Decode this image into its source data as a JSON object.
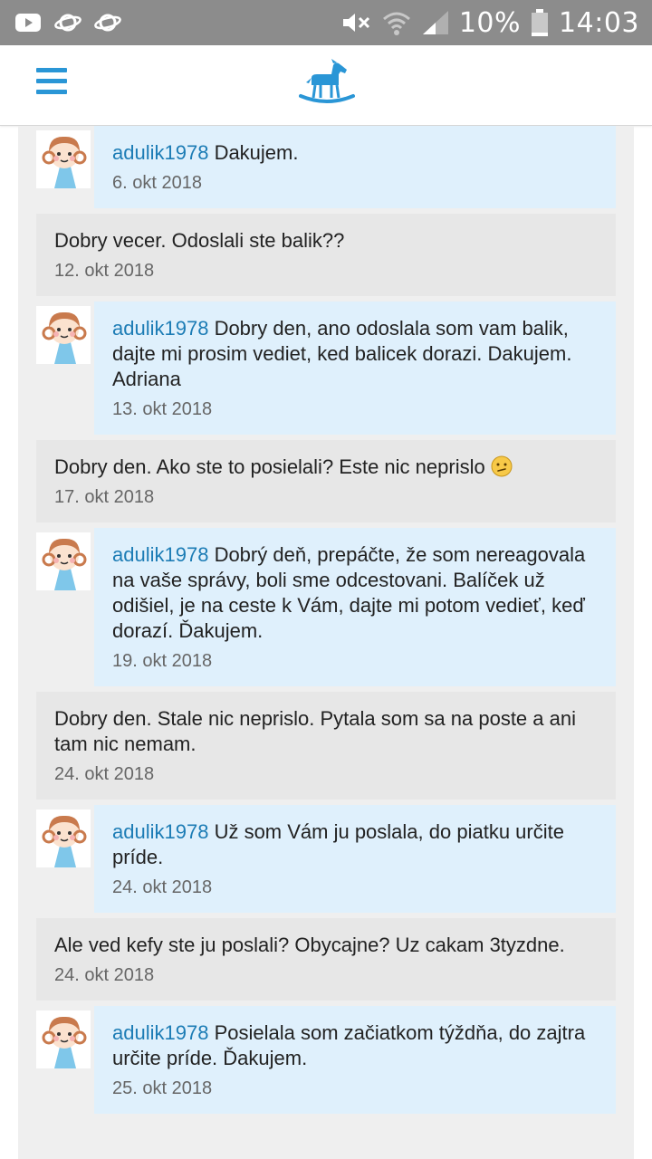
{
  "statusbar": {
    "battery": "10%",
    "time": "14:03"
  },
  "thread": {
    "messages": [
      {
        "type": "outgoing",
        "user": "adulik1978",
        "text": "Dakujem.",
        "date": "6. okt 2018"
      },
      {
        "type": "incoming",
        "text": "Dobry vecer. Odoslali ste balik??",
        "date": "12. okt 2018"
      },
      {
        "type": "outgoing",
        "user": "adulik1978",
        "text": "Dobry den, ano odoslala som vam balik, dajte mi prosim vediet, ked balicek dorazi. Dakujem. Adriana",
        "date": "13. okt 2018"
      },
      {
        "type": "incoming",
        "text": "Dobry den. Ako ste to posielali? Este nic neprislo",
        "emoji": "confused-face",
        "date": "17. okt 2018"
      },
      {
        "type": "outgoing",
        "user": "adulik1978",
        "text": "Dobrý deň, prepáčte, že som nereagovala na vaše správy, boli sme odcestovani. Balíček už odišiel, je na ceste k Vám, dajte mi potom vedieť, keď dorazí. Ďakujem.",
        "date": "19. okt 2018"
      },
      {
        "type": "incoming",
        "text": "Dobry den. Stale nic neprislo. Pytala som sa na poste a ani tam nic nemam.",
        "date": "24. okt 2018"
      },
      {
        "type": "outgoing",
        "user": "adulik1978",
        "text": "Už som Vám ju poslala, do piatku určite príde.",
        "date": "24. okt 2018"
      },
      {
        "type": "incoming",
        "text": "Ale ved kefy ste ju poslali? Obycajne? Uz cakam 3tyzdne.",
        "date": "24. okt 2018"
      },
      {
        "type": "outgoing",
        "user": "adulik1978",
        "text": "Posielala som začiatkom týždňa, do zajtra určite príde. Ďakujem.",
        "date": "25. okt 2018"
      }
    ]
  },
  "colors": {
    "accent": "#2a96d6",
    "outgoing_bg": "#dff0fc",
    "incoming_bg": "#e7e7e7",
    "username": "#1c7cb5"
  }
}
